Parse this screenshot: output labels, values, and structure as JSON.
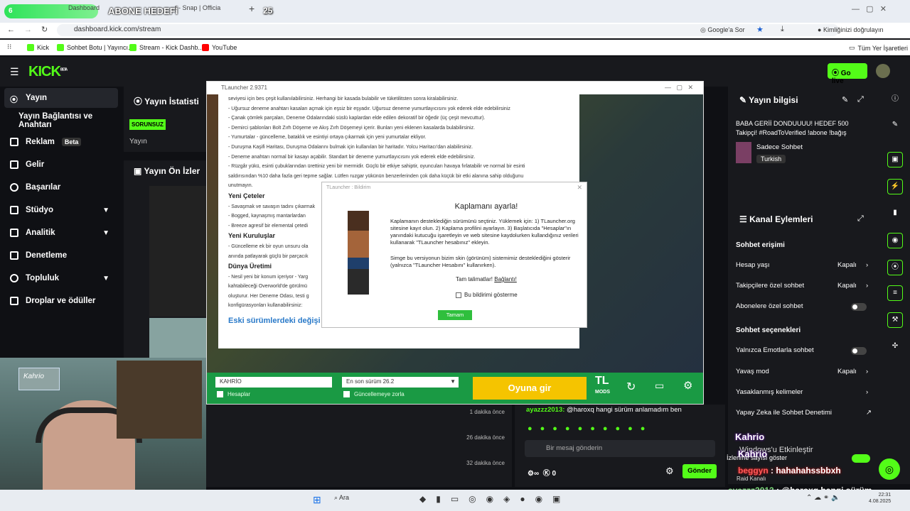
{
  "overlay": {
    "progress_count": "6",
    "abone": "ABONE HEDEFİ",
    "count_right": "25"
  },
  "browser": {
    "tabs": [
      "Dashboard",
      "t - Snap | Officia"
    ],
    "url": "dashboard.kick.com/stream",
    "google_btn": "Google'a Sor",
    "identity": "Kimliğinizi doğrulayın",
    "bookmarks": [
      "Kick",
      "Sohbet Botu | Yayıncı...",
      "Stream - Kick Dashb...",
      "YouTube"
    ],
    "all_bookmarks": "Tüm Yer İşaretleri"
  },
  "kick": {
    "logo": "KICK",
    "logo_sup": "BETA",
    "go_live": "Go live"
  },
  "sidebar": {
    "items": [
      {
        "label": "Yayın",
        "icon": "broadcast-icon"
      },
      {
        "label": "Yayın Bağlantısı ve Anahtarı",
        "icon": ""
      },
      {
        "label": "Reklam",
        "icon": "ad-icon",
        "badge": "Beta"
      },
      {
        "label": "Gelir",
        "icon": "revenue-icon"
      },
      {
        "label": "Başarılar",
        "icon": "trophy-icon"
      },
      {
        "label": "Stüdyo",
        "icon": "studio-icon"
      },
      {
        "label": "Analitik",
        "icon": "analytics-icon"
      },
      {
        "label": "Denetleme",
        "icon": "moderation-icon"
      },
      {
        "label": "Topluluk",
        "icon": "community-icon"
      },
      {
        "label": "Droplar ve ödüller",
        "icon": "drops-icon"
      }
    ]
  },
  "stats": {
    "title": "Yayın İstatisti",
    "badge": "SORUNSUZ",
    "label": "Yayın",
    "preview_title": "Yayın Ön İzler"
  },
  "launcher": {
    "title": "TLauncher 2.9371",
    "text_lines": [
      "seviyesi için bes çeşit kullanılabilirsiniz. Herhangi bir kasada bulabilir ve tüketilitsten sonra kiralabilirsiniz.",
      "- Uğursuz deneme anahtarı kasaları açmak için eşsiz bir eşyadır. Uğursuz deneme yumurtlayıcısını yok ederek elde edebilirsiniz",
      "- Çanak çömlek parçaları, Deneme Odalarındaki süslü kaplardan elde edilen dekoratif bir öğedir (üç çeşit mevcuttur).",
      "- Demirci şablonları Bolt Zırh Döşeme ve Akış Zırh Döşemeyi içerir. Bunları yeni eklenen kasalarda bulabilirsiniz.",
      "- Yumurtalar - güncelleme, bataklık ve esintiyi ortaya çıkarmak için yeni yumurtalar ekliyor.",
      "- Duruşma Kaşifi Haritası, Duruşma Odalarını bulmak için kullanılan bir haritadır. Yolcu Haritacı'dan alabilirsiniz.",
      "- Deneme anahtarı normal bir kasayı açabilir. Standart bir deneme yumurtlayıcısını yok ederek elde edebilirsiniz.",
      "- Rüzgâr yükü, esinti çubuklarından ürettiniz yeni bir mermidir. Güçlü bir etkiye sahiptir, oyuncuları havaya fırlatabilir ve normal bir esinti",
      "saldırısından %10 daha fazla geri tepme sağlar. Lütfen ruzgar yükünün benzerlerinden çok daha küçük bir etki alanına sahip olduğunu",
      "unutmayın."
    ],
    "h_yeni_ceteler": "Yeni Çeteler",
    "ceteler_lines": [
      "- Savaşmak ve savaşın tadını çıkarmak",
      "- Bogged, kaynaşmış mantarlardan",
      "- Breeze agresif bir elemental çetedi"
    ],
    "h_kurulus": "Yeni Kuruluşlar",
    "kurulus_lines": [
      "- Güncelleme ek bir oyun unsuru ola",
      "anında patlayarak güçlü bir parçacık"
    ],
    "h_dunya": "Dünya Üretimi",
    "dunya_lines": [
      "- Nesil yeni bir konum içeriyor - Yarg",
      "kahtabileceği Overworld'de görülmü",
      "oluşturur. Her Deneme Odası, testi g",
      "konfigürasyonları kullanabilirsiniz:"
    ],
    "old_link": "Eski sürümlerdeki değişi",
    "username": "KAHRİO",
    "accounts": "Hesaplar",
    "version": "En son sürüm 26.2",
    "force_update": "Güncellemeye zorla",
    "play": "Oyuna gir",
    "tl_logo": "TL",
    "tl_mods": "MODS"
  },
  "dialog": {
    "title": "TLauncher : Bildirim",
    "heading": "Kaplamanı ayarla!",
    "para1": "Kaplamanın desteklediğin sürümünü seçtiniz. Yüklemek için: 1) TLauncher.org sitesine kayıt olun. 2) Kaplama profilini ayarlayın. 3) Başlatıcıda \"Hesaplar\"ın yanındaki kutucuğu işaretleyin ve web sitesine kaydolurken kullandığınız verileri kullanarak \"TLauncher hesabınız\" ekleyin.",
    "para2": "Simge bu versiyonun bizim skin (görünüm) sistemimiz desteklediğini gösterir (yalnızca \"TLauncher Hesabını\" kullanırken).",
    "full_guide": "Tam talimatlar!",
    "link": "Bağlantı!",
    "checkbox": "Bu bildirimi gösterme",
    "ok": "Tamam"
  },
  "chat_times": [
    "1 dakika önce",
    "26 dakika önce",
    "32 dakika önce"
  ],
  "chat": {
    "last_msg_user": "ayazzz2013:",
    "last_msg_text": "@haroxq hangi sürüm anlamadım ben",
    "placeholder": "Bir mesaj gönderin",
    "points": "0",
    "send": "Gönder"
  },
  "stream_info": {
    "title": "Yayın bilgisi",
    "stream_title": "BABA GERİİ DONDUUUU! HEDEF 500 Takipçi! #RoadToVerified !abone !bağış",
    "chat_mode": "Sadece Sohbet",
    "language": "Turkish"
  },
  "channel_actions": {
    "title": "Kanal Eylemleri",
    "access_head": "Sohbet erişimi",
    "rows": [
      {
        "label": "Hesap yaşı",
        "value": "Kapalı",
        "kind": "chev"
      },
      {
        "label": "Takipçilere özel sohbet",
        "value": "Kapalı",
        "kind": "chev"
      },
      {
        "label": "Abonelere özel sohbet",
        "value": "",
        "kind": "toggle"
      }
    ],
    "options_head": "Sohbet seçenekleri",
    "rows2": [
      {
        "label": "Yalnızca Emotlarla sohbet",
        "value": "",
        "kind": "toggle"
      },
      {
        "label": "Yavaş mod",
        "value": "Kapalı",
        "kind": "chev"
      },
      {
        "label": "Yasaklanmış kelimeler",
        "value": "",
        "kind": "chev"
      },
      {
        "label": "Yapay Zeka ile Sohbet Denetimi",
        "value": "",
        "kind": "ext"
      }
    ]
  },
  "stream_overlay": {
    "cam_name": "Kahrio",
    "chat1_user": "Kahrio",
    "chat1_text": "Windows'u Etkinleştir",
    "chat2_user": "Kahrio",
    "chat2_text": "İzlenme sayısı göster",
    "chat3_user": "beggyn",
    "chat3_text": "hahahahssbbxh",
    "raid": "Raid Kanalı",
    "chat4_user": "ayazzz2013",
    "chat4_text": "@haroxq hangi sürüm anlamadım ben"
  },
  "taskbar": {
    "search": "Ara",
    "time": "22:31",
    "date": "4.08.2025"
  }
}
